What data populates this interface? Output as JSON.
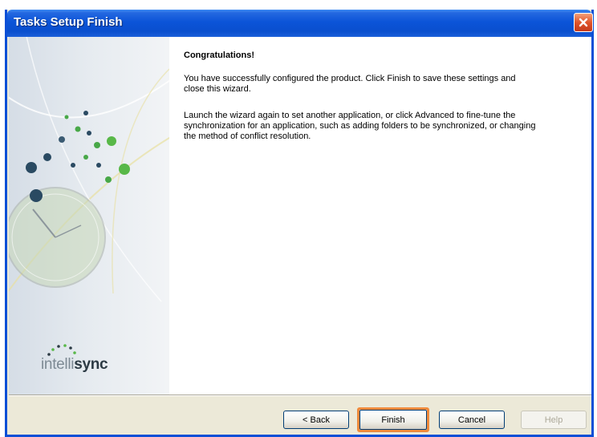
{
  "window": {
    "title": "Tasks Setup Finish"
  },
  "sidebar": {
    "brand_light": "intelli",
    "brand_bold": "sync"
  },
  "content": {
    "heading": "Congratulations!",
    "paragraph1": "You have successfully configured the product. Click Finish to save these settings and close this wizard.",
    "paragraph2": "Launch the wizard again to set another application, or click Advanced to fine-tune the synchronization for an application, such as adding folders to be synchronized, or changing the method of conflict resolution."
  },
  "buttons": {
    "back_label": "< Back",
    "finish_label": "Finish",
    "cancel_label": "Cancel",
    "help_label": "Help",
    "help_enabled": false
  },
  "colors": {
    "title_bar": "#0a4fd6",
    "close_button": "#e0542a",
    "highlight": "#f08a3c"
  }
}
